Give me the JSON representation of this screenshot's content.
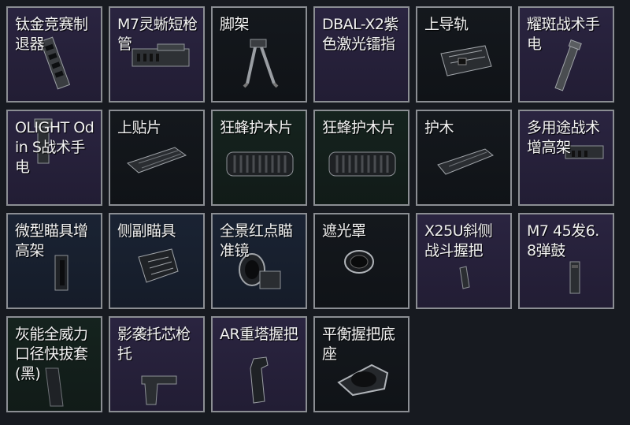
{
  "items": [
    {
      "label": "钛金竞赛制退器",
      "icon": "muzzle-brake-icon",
      "rarity": "purple"
    },
    {
      "label": "M7灵蜥短枪管",
      "icon": "short-barrel-icon",
      "rarity": "purple"
    },
    {
      "label": "脚架",
      "icon": "bipod-icon",
      "rarity": "dark"
    },
    {
      "label": "DBAL-X2紫色激光镭指",
      "icon": "laser-sight-icon",
      "rarity": "purple"
    },
    {
      "label": "上导轨",
      "icon": "top-rail-icon",
      "rarity": "dark"
    },
    {
      "label": "耀斑战术手电",
      "icon": "tactical-flashlight-icon",
      "rarity": "purple"
    },
    {
      "label": "OLIGHT Odin S战术手电",
      "icon": "olight-flashlight-icon",
      "rarity": "purple"
    },
    {
      "label": "上贴片",
      "icon": "rail-cover-icon",
      "rarity": "dark"
    },
    {
      "label": "狂蜂护木片",
      "icon": "handguard-panel-icon",
      "rarity": "green"
    },
    {
      "label": "狂蜂护木片",
      "icon": "handguard-panel-icon",
      "rarity": "green"
    },
    {
      "label": "护木",
      "icon": "handguard-icon",
      "rarity": "dark"
    },
    {
      "label": "多用途战术增高架",
      "icon": "riser-mount-icon",
      "rarity": "purple"
    },
    {
      "label": "微型瞄具增高架",
      "icon": "micro-riser-icon",
      "rarity": "blue"
    },
    {
      "label": "侧副瞄具",
      "icon": "offset-sight-icon",
      "rarity": "blue"
    },
    {
      "label": "全景红点瞄准镜",
      "icon": "red-dot-sight-icon",
      "rarity": "blue"
    },
    {
      "label": "遮光罩",
      "icon": "sunshade-icon",
      "rarity": "dark"
    },
    {
      "label": "X25U斜侧战斗握把",
      "icon": "angled-grip-icon",
      "rarity": "purple"
    },
    {
      "label": "M7 45发6.8弹鼓",
      "icon": "drum-magazine-icon",
      "rarity": "purple"
    },
    {
      "label": "灰能全威力口径快拔套(黑)",
      "icon": "suppressor-mount-icon",
      "rarity": "green"
    },
    {
      "label": "影袭托芯枪托",
      "icon": "stock-icon",
      "rarity": "purple"
    },
    {
      "label": "AR重塔握把",
      "icon": "pistol-grip-icon",
      "rarity": "purple"
    },
    {
      "label": "平衡握把底座",
      "icon": "grip-base-icon",
      "rarity": "dark"
    }
  ]
}
